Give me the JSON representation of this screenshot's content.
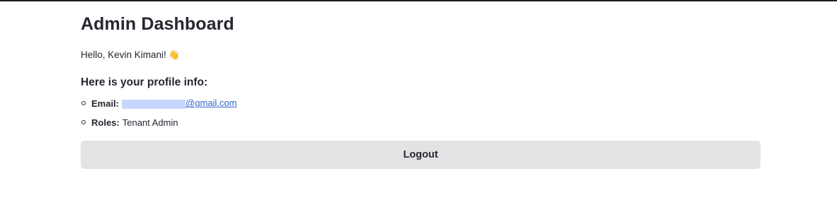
{
  "page": {
    "title": "Admin Dashboard",
    "greeting": "Hello, Kevin Kimani!",
    "greeting_icon": "waving-hand-icon",
    "profile_heading": "Here is your profile info:"
  },
  "profile": {
    "email_label": "Email:",
    "email_domain": "@gmail.com",
    "email_redacted": true,
    "roles_label": "Roles:",
    "roles_value": "Tenant Admin"
  },
  "actions": {
    "logout_label": "Logout"
  },
  "colors": {
    "accent_link": "#3366cc",
    "button_bg": "#e3e3e6",
    "redaction": "#c8d6ff"
  }
}
